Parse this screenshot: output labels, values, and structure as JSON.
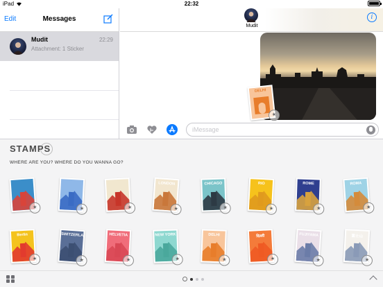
{
  "status": {
    "device": "iPad",
    "time": "22:32"
  },
  "sidebar": {
    "edit_label": "Edit",
    "title": "Messages",
    "conversations": [
      {
        "name": "Mudit",
        "time": "22:29",
        "preview": "Attachment: 1 Sticker"
      }
    ]
  },
  "chat": {
    "contact_name": "Mudit",
    "input_placeholder": "iMessage",
    "sticker_caption": "DELHI"
  },
  "drawer": {
    "app_name": "STAMPS",
    "tagline": "WHERE ARE YOU? WHERE DO YOU WANNA GO?",
    "stamps": [
      {
        "caption": "",
        "accent": "#d9443a",
        "sky": "#3b8ec9"
      },
      {
        "caption": "",
        "accent": "#3a6cc4",
        "sky": "#8fb8e8"
      },
      {
        "caption": "",
        "accent": "#c73529",
        "sky": "#f1e7cf"
      },
      {
        "caption": "LONDON",
        "accent": "#c9773a",
        "sky": "#f2e6cf"
      },
      {
        "caption": "CHICAGO",
        "accent": "#2d3a44",
        "sky": "#7bc4c9"
      },
      {
        "caption": "RIO",
        "accent": "#e09a1e",
        "sky": "#f6c21c"
      },
      {
        "caption": "ROME",
        "accent": "#d8a23e",
        "sky": "#2f3f8f"
      },
      {
        "caption": "ROMA",
        "accent": "#d48b3b",
        "sky": "#9fd3e6"
      },
      {
        "caption": "Berlin",
        "accent": "#e23b2e",
        "sky": "#f4c31e"
      },
      {
        "caption": "SWITZERLAND",
        "accent": "#3c4f72",
        "sky": "#5a6f97"
      },
      {
        "caption": "HELVETIA",
        "accent": "#d94855",
        "sky": "#f06d7a"
      },
      {
        "caption": "NEW YORK",
        "accent": "#4aa89c",
        "sky": "#8ed8d0"
      },
      {
        "caption": "DELHI",
        "accent": "#e87d2b",
        "sky": "#f8c59b"
      },
      {
        "caption": "दिल्ली",
        "accent": "#ef5a23",
        "sky": "#f47b3a"
      },
      {
        "caption": "FUJIYAMA",
        "accent": "#6b7ca8",
        "sky": "#eadfe8"
      },
      {
        "caption": "富士山",
        "accent": "#8a9ab7",
        "sky": "#f4f1ec"
      }
    ]
  },
  "colors": {
    "accent": "#0a7aff",
    "drawer_bg": "#f4f4f5"
  }
}
